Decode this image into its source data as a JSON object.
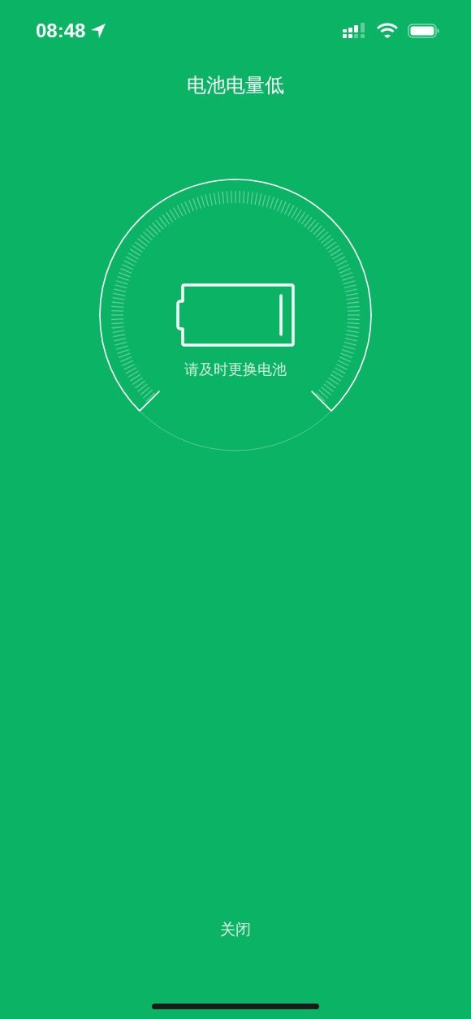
{
  "status_bar": {
    "time": "08:48"
  },
  "title": "电池电量低",
  "gauge": {
    "message": "请及时更换电池"
  },
  "close_button": {
    "label": "关闭"
  }
}
